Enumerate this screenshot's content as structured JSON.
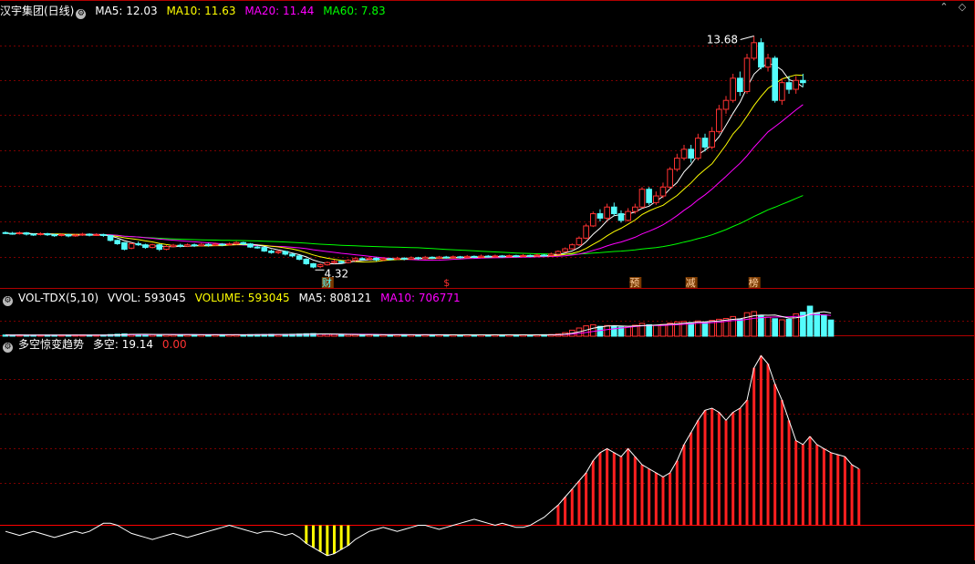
{
  "colors": {
    "up": "#ff3232",
    "down": "#54fcfc",
    "ma5": "#ffffff",
    "ma10": "#ffff00",
    "ma20": "#ff00ff",
    "ma60": "#00ff00",
    "white": "#ffffff",
    "axis": "#b00000",
    "vol_ma5": "#ffffff",
    "vol_ma10": "#ff00ff",
    "osc_down": "#ffff00",
    "osc_up": "#ff2020",
    "label_red": "#ff3232"
  },
  "price": {
    "stock_name": "汉宇集团(日线)",
    "ma5_label": "MA5: 12.03",
    "ma10_label": "MA10: 11.63",
    "ma20_label": "MA20: 11.44",
    "ma60_label": "MA60: 7.83",
    "high_label": "13.68",
    "low_label": "4.32",
    "events": [
      {
        "text": "财",
        "index": 46
      },
      {
        "text": "$",
        "index": 63
      },
      {
        "text": "预",
        "index": 90
      },
      {
        "text": "减",
        "index": 98
      },
      {
        "text": "榜",
        "index": 107
      }
    ],
    "ylim": [
      3.0,
      15.1
    ],
    "candles": [
      [
        5.45,
        5.42,
        5.5,
        5.38
      ],
      [
        5.42,
        5.4,
        5.48,
        5.35
      ],
      [
        5.4,
        5.44,
        5.5,
        5.36
      ],
      [
        5.44,
        5.38,
        5.48,
        5.32
      ],
      [
        5.38,
        5.36,
        5.42,
        5.3
      ],
      [
        5.36,
        5.4,
        5.46,
        5.32
      ],
      [
        5.4,
        5.35,
        5.44,
        5.3
      ],
      [
        5.35,
        5.32,
        5.4,
        5.26
      ],
      [
        5.32,
        5.36,
        5.42,
        5.28
      ],
      [
        5.36,
        5.3,
        5.4,
        5.24
      ],
      [
        5.3,
        5.34,
        5.4,
        5.26
      ],
      [
        5.34,
        5.38,
        5.44,
        5.3
      ],
      [
        5.38,
        5.33,
        5.42,
        5.28
      ],
      [
        5.33,
        5.36,
        5.42,
        5.3
      ],
      [
        5.36,
        5.32,
        5.4,
        5.26
      ],
      [
        5.32,
        5.1,
        5.34,
        5.05
      ],
      [
        5.1,
        4.95,
        5.14,
        4.9
      ],
      [
        5.0,
        4.7,
        5.02,
        4.65
      ],
      [
        4.75,
        4.95,
        5.0,
        4.7
      ],
      [
        4.95,
        4.9,
        5.05,
        4.85
      ],
      [
        4.9,
        4.78,
        4.95,
        4.72
      ],
      [
        4.78,
        4.9,
        4.95,
        4.74
      ],
      [
        4.9,
        4.7,
        4.95,
        4.62
      ],
      [
        4.7,
        4.82,
        4.88,
        4.65
      ],
      [
        4.82,
        4.88,
        4.94,
        4.78
      ],
      [
        4.88,
        4.84,
        4.95,
        4.78
      ],
      [
        4.84,
        4.9,
        4.96,
        4.8
      ],
      [
        4.9,
        4.86,
        4.96,
        4.8
      ],
      [
        4.86,
        4.92,
        4.98,
        4.82
      ],
      [
        4.92,
        4.88,
        4.98,
        4.82
      ],
      [
        4.88,
        4.93,
        5.0,
        4.84
      ],
      [
        4.93,
        4.9,
        4.98,
        4.84
      ],
      [
        4.9,
        4.94,
        5.0,
        4.86
      ],
      [
        4.94,
        5.0,
        5.06,
        4.9
      ],
      [
        5.0,
        4.94,
        5.04,
        4.88
      ],
      [
        4.94,
        4.8,
        4.98,
        4.76
      ],
      [
        4.8,
        4.78,
        4.86,
        4.72
      ],
      [
        4.78,
        4.62,
        4.82,
        4.58
      ],
      [
        4.62,
        4.55,
        4.68,
        4.5
      ],
      [
        4.55,
        4.6,
        4.65,
        4.48
      ],
      [
        4.6,
        4.48,
        4.64,
        4.42
      ],
      [
        4.48,
        4.4,
        4.52,
        4.34
      ],
      [
        4.4,
        4.25,
        4.44,
        4.2
      ],
      [
        4.25,
        4.05,
        4.3,
        4.0
      ],
      [
        4.05,
        3.9,
        4.08,
        3.85
      ],
      [
        3.92,
        4.0,
        4.06,
        3.85
      ],
      [
        4.0,
        4.1,
        4.15,
        3.96
      ],
      [
        4.1,
        4.15,
        4.22,
        4.05
      ],
      [
        4.15,
        4.1,
        4.2,
        4.05
      ],
      [
        4.1,
        4.2,
        4.26,
        4.06
      ],
      [
        4.2,
        4.28,
        4.34,
        4.15
      ],
      [
        4.28,
        4.25,
        4.34,
        4.2
      ],
      [
        4.25,
        4.3,
        4.36,
        4.2
      ],
      [
        4.3,
        4.22,
        4.34,
        4.16
      ],
      [
        4.22,
        4.28,
        4.34,
        4.18
      ],
      [
        4.28,
        4.25,
        4.32,
        4.2
      ],
      [
        4.25,
        4.3,
        4.36,
        4.22
      ],
      [
        4.3,
        4.26,
        4.34,
        4.2
      ],
      [
        4.26,
        4.32,
        4.38,
        4.22
      ],
      [
        4.32,
        4.28,
        4.36,
        4.22
      ],
      [
        4.28,
        4.34,
        4.4,
        4.24
      ],
      [
        4.34,
        4.3,
        4.38,
        4.26
      ],
      [
        4.3,
        4.35,
        4.4,
        4.26
      ],
      [
        4.35,
        4.32,
        4.4,
        4.28
      ],
      [
        4.32,
        4.36,
        4.42,
        4.28
      ],
      [
        4.36,
        4.33,
        4.4,
        4.28
      ],
      [
        4.33,
        4.38,
        4.44,
        4.3
      ],
      [
        4.38,
        4.34,
        4.42,
        4.3
      ],
      [
        4.34,
        4.39,
        4.46,
        4.3
      ],
      [
        4.39,
        4.36,
        4.44,
        4.32
      ],
      [
        4.36,
        4.4,
        4.46,
        4.32
      ],
      [
        4.4,
        4.37,
        4.44,
        4.32
      ],
      [
        4.37,
        4.41,
        4.46,
        4.33
      ],
      [
        4.41,
        4.38,
        4.45,
        4.34
      ],
      [
        4.38,
        4.42,
        4.48,
        4.34
      ],
      [
        4.42,
        4.4,
        4.46,
        4.35
      ],
      [
        4.4,
        4.44,
        4.5,
        4.36
      ],
      [
        4.44,
        4.42,
        4.48,
        4.38
      ],
      [
        4.42,
        4.48,
        4.55,
        4.38
      ],
      [
        4.48,
        4.6,
        4.65,
        4.44
      ],
      [
        4.6,
        4.72,
        4.78,
        4.55
      ],
      [
        4.72,
        4.9,
        4.96,
        4.68
      ],
      [
        4.9,
        5.2,
        5.28,
        4.85
      ],
      [
        5.2,
        5.75,
        5.85,
        5.15
      ],
      [
        5.75,
        6.3,
        6.4,
        5.7
      ],
      [
        6.3,
        6.1,
        6.5,
        5.95
      ],
      [
        6.1,
        6.6,
        6.75,
        6.0
      ],
      [
        6.6,
        6.3,
        6.8,
        6.2
      ],
      [
        6.3,
        6.0,
        6.45,
        5.9
      ],
      [
        6.0,
        6.4,
        6.55,
        5.95
      ],
      [
        6.4,
        6.6,
        6.75,
        6.3
      ],
      [
        6.6,
        7.4,
        7.5,
        6.55
      ],
      [
        7.4,
        6.8,
        7.5,
        6.7
      ],
      [
        6.8,
        7.1,
        7.3,
        6.7
      ],
      [
        7.1,
        7.5,
        7.7,
        7.0
      ],
      [
        7.5,
        8.3,
        8.4,
        7.4
      ],
      [
        8.3,
        8.8,
        9.0,
        8.2
      ],
      [
        8.8,
        9.2,
        9.4,
        8.7
      ],
      [
        9.2,
        8.8,
        9.4,
        8.6
      ],
      [
        8.8,
        9.7,
        9.9,
        8.7
      ],
      [
        9.7,
        9.3,
        9.9,
        9.1
      ],
      [
        9.3,
        10.0,
        10.2,
        9.2
      ],
      [
        10.0,
        11.0,
        11.2,
        9.9
      ],
      [
        11.0,
        11.4,
        11.6,
        10.8
      ],
      [
        11.4,
        12.4,
        12.6,
        11.3
      ],
      [
        12.4,
        11.8,
        12.7,
        11.6
      ],
      [
        11.8,
        13.3,
        13.5,
        11.7
      ],
      [
        13.3,
        14.0,
        14.3,
        13.2
      ],
      [
        14.0,
        12.9,
        14.2,
        12.8
      ],
      [
        12.9,
        13.3,
        13.5,
        12.7
      ],
      [
        13.3,
        11.4,
        13.4,
        11.3
      ],
      [
        11.4,
        12.2,
        12.4,
        11.2
      ],
      [
        12.2,
        11.9,
        12.5,
        11.7
      ],
      [
        11.9,
        12.3,
        12.5,
        11.7
      ],
      [
        12.3,
        12.2,
        12.6,
        12.0
      ]
    ]
  },
  "volume": {
    "label": "VOL-TDX(5,10)",
    "vvol_label": "VVOL: 593045",
    "volume_label": "VOLUME: 593045",
    "ma5_label": "MA5: 808121",
    "ma10_label": "MA10: 706771",
    "ylim": [
      0,
      1100000
    ],
    "values": [
      45000,
      42000,
      48000,
      40000,
      38000,
      44000,
      41000,
      39000,
      43000,
      40000,
      42000,
      45000,
      41000,
      40000,
      43000,
      60000,
      72000,
      85000,
      70000,
      62000,
      66000,
      58000,
      64000,
      59000,
      56000,
      54000,
      57000,
      55000,
      53000,
      52000,
      54000,
      51000,
      53000,
      56000,
      50000,
      58000,
      60000,
      64000,
      70000,
      62000,
      68000,
      72000,
      80000,
      90000,
      96000,
      78000,
      70000,
      66000,
      62000,
      60000,
      58000,
      56000,
      54000,
      52000,
      55000,
      53000,
      51000,
      54000,
      52000,
      50000,
      53000,
      51000,
      49000,
      52000,
      50000,
      48000,
      51000,
      49000,
      50000,
      48000,
      52000,
      50000,
      49000,
      51000,
      48000,
      50000,
      53000,
      55000,
      60000,
      80000,
      130000,
      220000,
      300000,
      380000,
      420000,
      360000,
      390000,
      370000,
      340000,
      360000,
      400000,
      470000,
      420000,
      400000,
      430000,
      480000,
      520000,
      540000,
      500000,
      560000,
      520000,
      580000,
      620000,
      650000,
      720000,
      620000,
      860000,
      900000,
      760000,
      700000,
      640000,
      600000,
      620000,
      820000,
      880000,
      1150000,
      850000,
      780000,
      593045
    ]
  },
  "oscillator": {
    "label": "多空惊变趋势",
    "value_label": "多空: 19.14",
    "second_label": "0.00",
    "ylim": [
      -16,
      86
    ],
    "values": [
      -3,
      -4,
      -5,
      -4,
      -3,
      -4,
      -5,
      -6,
      -5,
      -4,
      -3,
      -4,
      -3,
      -1,
      1,
      1,
      0,
      -2,
      -4,
      -5,
      -6,
      -7,
      -6,
      -5,
      -4,
      -5,
      -6,
      -5,
      -4,
      -3,
      -2,
      -1,
      0,
      -1,
      -2,
      -3,
      -4,
      -3,
      -3,
      -4,
      -5,
      -4,
      -6,
      -9,
      -11,
      -13,
      -15,
      -14,
      -12,
      -10,
      -7,
      -5,
      -3,
      -2,
      -1,
      -2,
      -3,
      -2,
      -1,
      0,
      0,
      -1,
      -2,
      -1,
      0,
      1,
      2,
      3,
      2,
      1,
      0,
      1,
      0,
      -1,
      -1,
      0,
      2,
      4,
      7,
      10,
      14,
      18,
      22,
      26,
      32,
      36,
      38,
      36,
      34,
      38,
      34,
      30,
      28,
      26,
      24,
      26,
      32,
      40,
      46,
      52,
      57,
      58,
      56,
      52,
      56,
      58,
      62,
      78,
      84,
      80,
      70,
      62,
      52,
      42,
      40,
      44,
      40,
      38,
      36,
      35,
      34,
      30,
      28
    ]
  }
}
